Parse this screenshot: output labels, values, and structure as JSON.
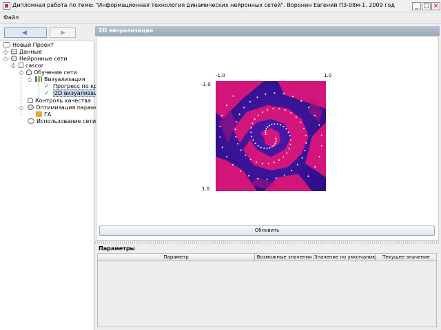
{
  "window": {
    "title": "Дипломная работа по теме: \"Информационная технология динамических нейронных сетей\". Воронин Евгений  ПЗ-08м-1. 2009 год",
    "buttons": {
      "minimize": "_",
      "maximize": "□",
      "close": "×"
    }
  },
  "menu": {
    "file": "Файл"
  },
  "nav": {
    "back_icon": "arrow-left-icon",
    "forward_icon": "arrow-right-icon"
  },
  "tree": {
    "project": "Новый Проект",
    "data": "Данные",
    "networks": "Нейронные сети",
    "cascor": "cascor",
    "training": "Обучение сети",
    "visualization": "Визуализация",
    "progress": "Прогресс по кр",
    "viz2d": "2D визуализац",
    "quality": "Контроль качества",
    "optimization": "Оптимизация параме",
    "ga": "ГА",
    "usage": "Использование сети"
  },
  "viz": {
    "header": "2D визуализация",
    "x_min_label": "-1.0",
    "x_max_label": "1.0",
    "y_min_label": "-1.0",
    "y_max_label": "1.0",
    "refresh": "Обновить",
    "colors": {
      "class_a": "#e0167a",
      "class_b": "#3a0fa0"
    }
  },
  "params": {
    "title": "Параметры",
    "columns": [
      "Параметр",
      "Возможные значения",
      "Значение по умолчанию",
      "Текущее значение"
    ]
  }
}
